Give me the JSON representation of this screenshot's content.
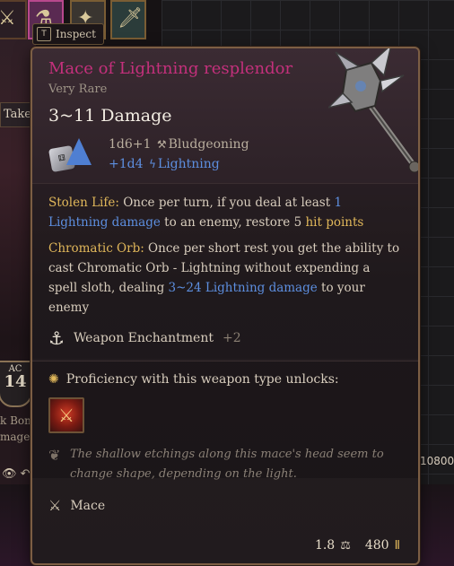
{
  "inventory": {
    "inspect_key": "T",
    "inspect_label": "Inspect",
    "take_label": "Take",
    "ac_label": "AC",
    "ac_value": "14",
    "partial_text_1": "k Bon",
    "partial_text_2": "mage",
    "gold_partial": "10800"
  },
  "tooltip": {
    "item_name": "Mace of Lightning resplendor",
    "rarity": "Very Rare",
    "damage_title": "3~11 Damage",
    "damage_roll_1": "1d6+1",
    "damage_type_1": "Bludgeoning",
    "damage_roll_2": "+1d4",
    "damage_type_2": "Lightning",
    "props": {
      "stolen_life_name": "Stolen Life:",
      "stolen_life_text_a": " Once per turn, if you deal at least ",
      "stolen_life_amount": "1 Lightning damage",
      "stolen_life_text_b": " to an enemy, restore 5 ",
      "stolen_life_hp": "hit points",
      "chromatic_orb_name": "Chromatic Orb:",
      "chromatic_orb_text_a": " Once per short rest you get the ability to cast Chromatic Orb - Lightning without expending a spell sloth, dealing ",
      "chromatic_orb_damage": "3~24 Lightning damage",
      "chromatic_orb_text_b": " to your enemy"
    },
    "enchantment_label": "Weapon Enchantment",
    "enchantment_value": "+2",
    "proficiency_label": "Proficiency with this weapon type unlocks:",
    "flavor_text": "The shallow etchings along this mace's head seem to change shape, depending on the light.",
    "weapon_type": "Mace",
    "weight": "1.8",
    "value": "480",
    "icons": {
      "dice_d6": "d6-dice-icon",
      "dice_d4": "d4-dice-icon",
      "bludgeon": "hammer-icon",
      "lightning": "lightning-icon",
      "enchant": "anvil-icon",
      "proficiency": "gear-icon",
      "flavor": "feather-icon",
      "type": "crossed-weapons-icon",
      "weight": "weight-icon",
      "gold": "gold-coin-icon"
    },
    "colors": {
      "name": "#c4307c",
      "keyword": "#e0b75a",
      "lightning": "#5d8fe0"
    }
  }
}
